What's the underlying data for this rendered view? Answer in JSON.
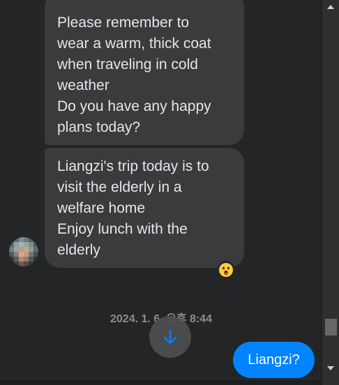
{
  "conversation": {
    "incoming_messages": [
      {
        "lines": [
          "Please remember to",
          "wear a warm, thick coat",
          "when traveling in cold",
          "weather",
          "Do you have any happy",
          "plans today?"
        ]
      },
      {
        "lines": [
          "Liangzi's trip today is to",
          "visit the elderly in a",
          "welfare home",
          "Enjoy lunch with the",
          "elderly"
        ]
      }
    ],
    "reaction_emoji": "😮",
    "timestamp": "2024. 1. 6. 오후 8:44",
    "outgoing_message": "Liangzi?"
  },
  "icons": {
    "avatar": "blurred-avatar",
    "reaction": "surprised-face-emoji",
    "scroll_down": "arrow-down-icon",
    "scrollbar_up": "triangle-up-icon",
    "scrollbar_down": "triangle-down-icon"
  },
  "colors": {
    "background": "#242526",
    "incoming_bubble": "#3a3b3c",
    "outgoing_bubble": "#0084ff",
    "scroll_arrow": "#0a84ff",
    "timestamp_text": "#8a8d91"
  }
}
